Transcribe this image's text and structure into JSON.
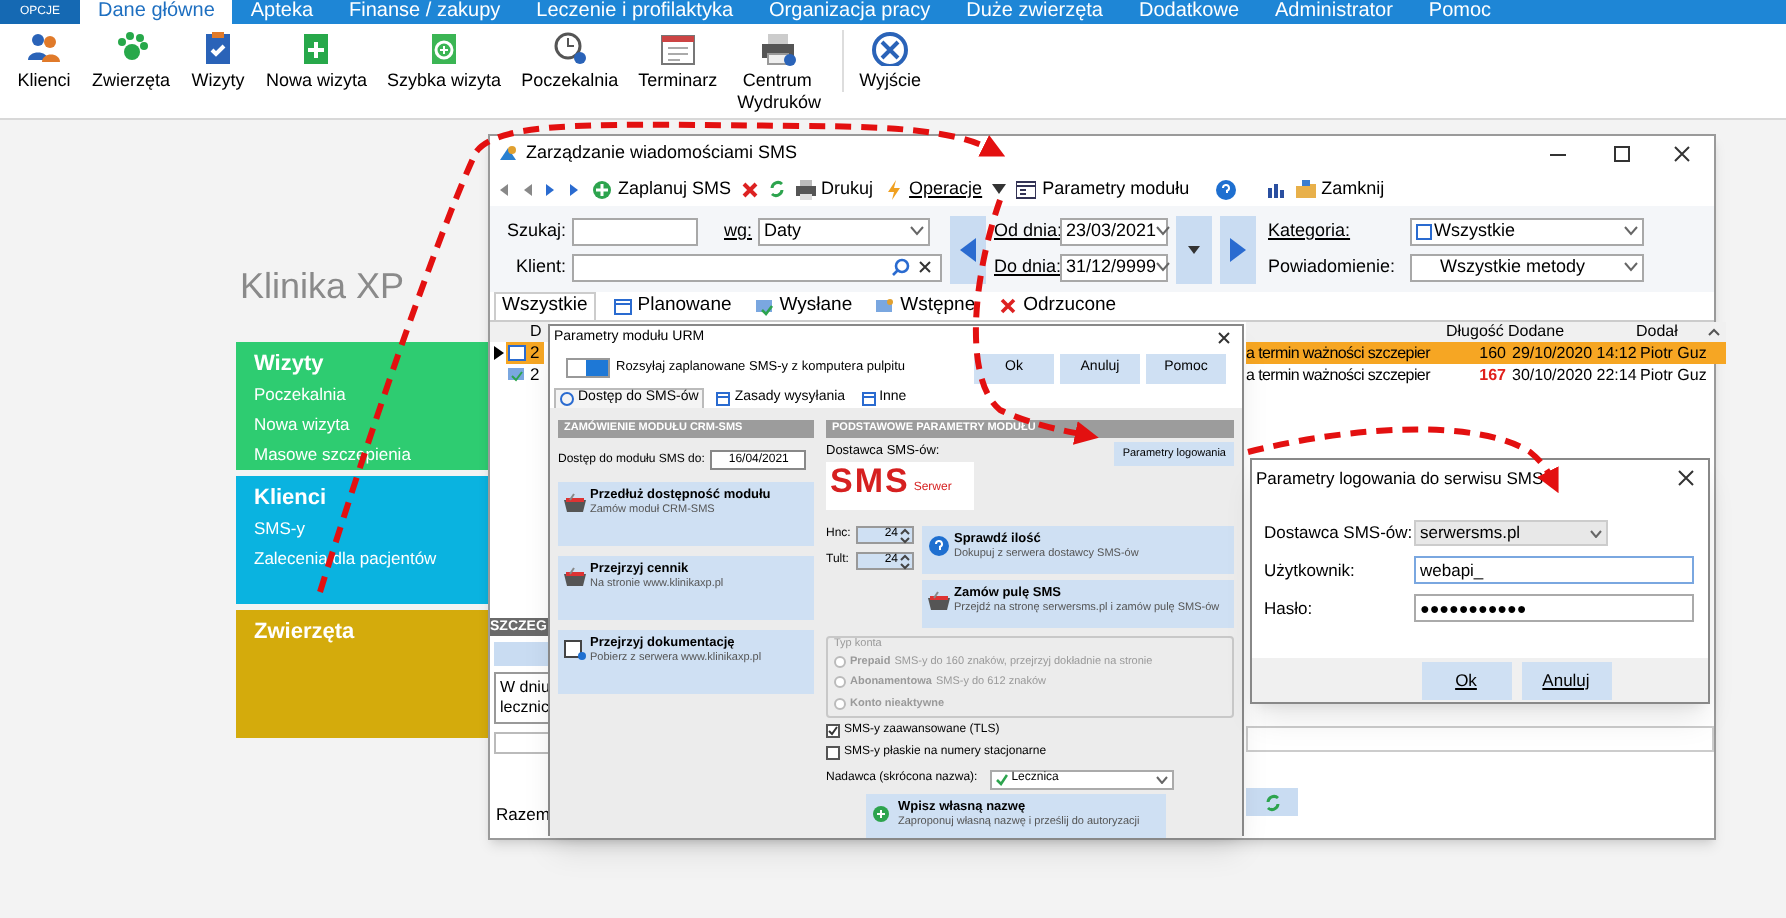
{
  "menu_bar": {
    "options_button": "OPCJE",
    "tabs": [
      {
        "label": "Dane główne",
        "selected": true
      },
      {
        "label": "Apteka",
        "selected": false
      },
      {
        "label": "Finanse / zakupy",
        "selected": false
      },
      {
        "label": "Leczenie i profilaktyka",
        "selected": false
      },
      {
        "label": "Organizacja pracy",
        "selected": false
      },
      {
        "label": "Duże zwierzęta",
        "selected": false
      },
      {
        "label": "Dodatkowe",
        "selected": false
      },
      {
        "label": "Administrator",
        "selected": false
      },
      {
        "label": "Pomoc",
        "selected": false
      }
    ]
  },
  "ribbon": {
    "buttons": [
      "Klienci",
      "Zwierzęta",
      "Wizyty",
      "Nowa wizyta",
      "Szybka wizyta",
      "Poczekalnia",
      "Terminarz",
      "Centrum Wydruków",
      "Wyjście"
    ]
  },
  "app_title": "Klinika XP",
  "tiles": [
    {
      "title": "Wizyty",
      "color": "#2ecc71",
      "items": [
        "Poczekalnia",
        "Nowa wizyta",
        "Masowe szczepienia"
      ]
    },
    {
      "title": "Klienci",
      "color": "#0ab3e0",
      "items": [
        "SMS-y",
        "Zalecenia dla pacjentów"
      ]
    },
    {
      "title": "Zwierzęta",
      "color": "#d4ab0c"
    }
  ],
  "sms_window": {
    "title": "Zarządzanie wiadomościami SMS",
    "toolbar": [
      "Zaplanuj SMS",
      "Drukuj",
      "Operacje",
      "Parametry modułu",
      "Zamknij"
    ],
    "search_label": "Szukaj:",
    "by_label": "wg:",
    "by_value": "Daty",
    "client_label": "Klient:",
    "from_label": "Od dnia:",
    "from_value": "23/03/2021",
    "to_label": "Do dnia:",
    "to_value": "31/12/9999",
    "category_label": "Kategoria:",
    "category_value": "Wszystkie",
    "notification_label": "Powiadomienie:",
    "notification_value": "Wszystkie metody",
    "tabs": [
      {
        "label": "Wszystkie",
        "selected": true
      },
      {
        "label": "Planowane",
        "selected": false
      },
      {
        "label": "Wysłane",
        "selected": false
      },
      {
        "label": "Wstępne",
        "selected": false
      },
      {
        "label": "Odrzucone",
        "selected": false
      }
    ],
    "grid": {
      "column_1": "D",
      "columns": [
        "Długość",
        "Dodane",
        "Dodał"
      ],
      "rows": [
        {
          "selected": true,
          "column_1": "2",
          "content": "a termin ważności szczepier",
          "length": "160",
          "length_over": false,
          "added": "29/10/2020 14:12",
          "author": "Piotr Guz"
        },
        {
          "selected": false,
          "column_1": "2",
          "content": "a termin ważności szczepier",
          "length": "167",
          "length_over": true,
          "added": "30/10/2020 22:14",
          "author": "Piotr Guz"
        }
      ]
    },
    "details_title": "SZCZEG",
    "details_text": [
      "W dniu",
      "lecznic"
    ],
    "total_label": "Razem"
  },
  "module_dialog": {
    "title": "Parametry modułu URM",
    "toggle_on": true,
    "toggle_label": "Rozsyłaj zaplanowane SMS-y z komputera pulpitu",
    "buttons": [
      "Ok",
      "Anuluj",
      "Pomoc"
    ],
    "tabs": [
      {
        "label": "Dostęp do SMS-ów",
        "selected": true
      },
      {
        "label": "Zasady wysyłania",
        "selected": false
      },
      {
        "label": "Inne",
        "selected": false
      }
    ],
    "left_header": "ZAMÓWIENIE MODUŁU CRM-SMS",
    "access_label": "Dostęp do modułu SMS do:",
    "access_value": "16/04/2021",
    "left_actions": [
      {
        "title": "Przedłuż dostępność modułu",
        "subtitle": "Zamów moduł CRM-SMS"
      },
      {
        "title": "Przejrzyj cennik",
        "subtitle": "Na stronie www.klinikaxp.pl"
      },
      {
        "title": "Przejrzyj dokumentację",
        "subtitle": "Pobierz z serwera www.klinikaxp.pl"
      }
    ],
    "right_header": "PODSTAWOWE PARAMETRY MODUŁU",
    "provider_label": "Dostawca SMS-ów:",
    "login_button": "Parametry logowania",
    "logo_text": "SMS",
    "logo_suffix": "Serwer",
    "spinners": [
      {
        "label": "Hnc:",
        "value": "24"
      },
      {
        "label": "Tult:",
        "value": "24"
      }
    ],
    "right_actions": [
      {
        "title": "Sprawdź ilość",
        "subtitle": "Dokupuj z serwera dostawcy SMS-ów"
      },
      {
        "title": "Zamów pulę SMS",
        "subtitle": "Przejdź na stronę serwersms.pl i zamów pulę SMS-ów"
      }
    ],
    "account_group": "Typ konta",
    "accounts": [
      {
        "label": "Prepaid",
        "note": "SMS-y do 160 znaków, przejrzyj dokładnie na stronie",
        "selected": false
      },
      {
        "label": "Abonamentowa",
        "note": "SMS-y do 612 znaków",
        "selected": false
      },
      {
        "label": "Konto nieaktywne",
        "selected": false
      }
    ],
    "checkboxes": [
      {
        "label": "SMS-y zaawansowane (TLS)",
        "checked": true
      },
      {
        "label": "SMS-y płaskie na numery stacjonarne",
        "checked": false
      }
    ],
    "sender_label": "Nadawca (skrócona nazwa):",
    "sender_value": "Lecznica",
    "sender_action": {
      "title": "Wpisz własną nazwę",
      "subtitle": "Zaproponuj własną nazwę i prześlij do autoryzacji"
    }
  },
  "login_dialog": {
    "title": "Parametry logowania do serwisu SMS",
    "provider_label": "Dostawca SMS-ów:",
    "provider_value": "serwersms.pl",
    "user_label": "Użytkownik:",
    "user_value": "webapi_",
    "password_label": "Hasło:",
    "password_value": "●●●●●●●●●●●",
    "buttons": [
      "Ok",
      "Anuluj"
    ]
  }
}
